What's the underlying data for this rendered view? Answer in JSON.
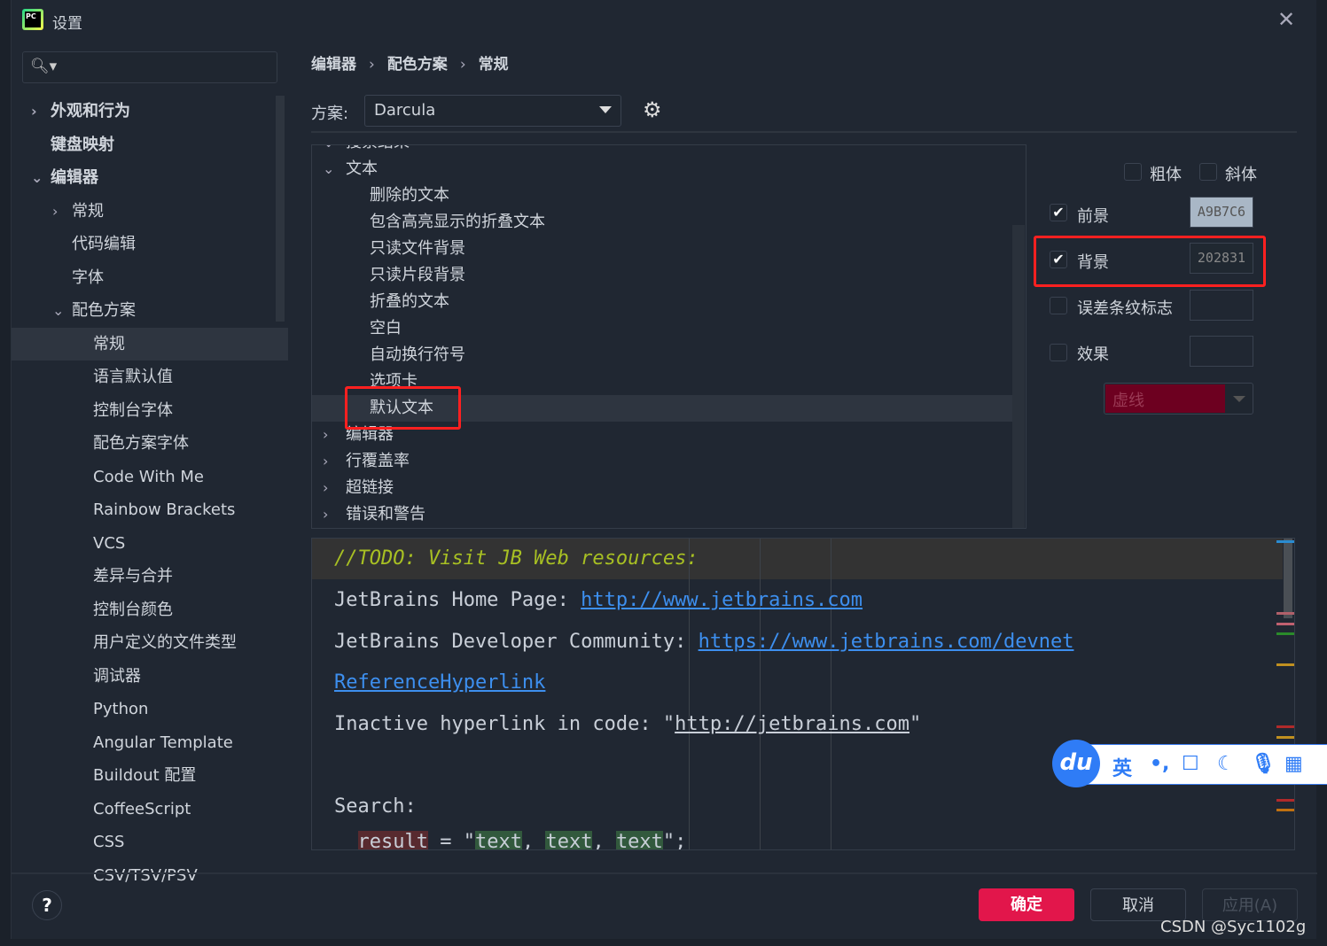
{
  "window": {
    "title": "设置",
    "close_icon": "close-icon"
  },
  "search": {
    "placeholder": ""
  },
  "sidebar": {
    "items": [
      {
        "label": "外观和行为",
        "level": 0,
        "expander": "right",
        "bold": true
      },
      {
        "label": "键盘映射",
        "level": 0,
        "expander": "",
        "bold": true
      },
      {
        "label": "编辑器",
        "level": 0,
        "expander": "down",
        "bold": true
      },
      {
        "label": "常规",
        "level": 1,
        "expander": "right"
      },
      {
        "label": "代码编辑",
        "level": 1,
        "expander": ""
      },
      {
        "label": "字体",
        "level": 1,
        "expander": ""
      },
      {
        "label": "配色方案",
        "level": 1,
        "expander": "down"
      },
      {
        "label": "常规",
        "level": 2,
        "expander": "",
        "selected": true
      },
      {
        "label": "语言默认值",
        "level": 2,
        "expander": ""
      },
      {
        "label": "控制台字体",
        "level": 2,
        "expander": ""
      },
      {
        "label": "配色方案字体",
        "level": 2,
        "expander": ""
      },
      {
        "label": "Code With Me",
        "level": 2,
        "expander": ""
      },
      {
        "label": "Rainbow Brackets",
        "level": 2,
        "expander": ""
      },
      {
        "label": "VCS",
        "level": 2,
        "expander": ""
      },
      {
        "label": "差异与合并",
        "level": 2,
        "expander": ""
      },
      {
        "label": "控制台颜色",
        "level": 2,
        "expander": ""
      },
      {
        "label": "用户定义的文件类型",
        "level": 2,
        "expander": ""
      },
      {
        "label": "调试器",
        "level": 2,
        "expander": ""
      },
      {
        "label": "Python",
        "level": 2,
        "expander": ""
      },
      {
        "label": "Angular Template",
        "level": 2,
        "expander": ""
      },
      {
        "label": "Buildout 配置",
        "level": 2,
        "expander": ""
      },
      {
        "label": "CoffeeScript",
        "level": 2,
        "expander": ""
      },
      {
        "label": "CSS",
        "level": 2,
        "expander": ""
      },
      {
        "label": "CSV/TSV/PSV",
        "level": 2,
        "expander": ""
      }
    ]
  },
  "breadcrumb": [
    "编辑器",
    "配色方案",
    "常规"
  ],
  "scheme": {
    "label": "方案:",
    "value": "Darcula"
  },
  "tree": {
    "items": [
      {
        "label": "搜索结果",
        "level": 0,
        "expander": "down"
      },
      {
        "label": "文本",
        "level": 0,
        "expander": "down"
      },
      {
        "label": "删除的文本",
        "level": 1
      },
      {
        "label": "包含高亮显示的折叠文本",
        "level": 1
      },
      {
        "label": "只读文件背景",
        "level": 1
      },
      {
        "label": "只读片段背景",
        "level": 1
      },
      {
        "label": "折叠的文本",
        "level": 1
      },
      {
        "label": "空白",
        "level": 1
      },
      {
        "label": "自动换行符号",
        "level": 1
      },
      {
        "label": "选项卡",
        "level": 1
      },
      {
        "label": "默认文本",
        "level": 1,
        "selected": true
      },
      {
        "label": "编辑器",
        "level": 0,
        "expander": "right"
      },
      {
        "label": "行覆盖率",
        "level": 0,
        "expander": "right"
      },
      {
        "label": "超链接",
        "level": 0,
        "expander": "right"
      },
      {
        "label": "错误和警告",
        "level": 0,
        "expander": "right"
      }
    ]
  },
  "attributes": {
    "bold": {
      "label": "粗体",
      "checked": false
    },
    "italic": {
      "label": "斜体",
      "checked": false
    },
    "foreground": {
      "label": "前景",
      "checked": true,
      "value": "A9B7C6",
      "color": "#A9B7C6"
    },
    "background": {
      "label": "背景",
      "checked": true,
      "value": "202831",
      "color": "#202831"
    },
    "error_stripe": {
      "label": "误差条纹标志",
      "checked": false,
      "value": ""
    },
    "effects": {
      "label": "效果",
      "checked": false,
      "value": "",
      "type": "虚线",
      "type_color": "#6d0020"
    }
  },
  "preview": {
    "todo": "//TODO: Visit JB Web resources:",
    "home_label": "JetBrains Home Page: ",
    "home_link": "http://www.jetbrains.com",
    "dev_label": "JetBrains Developer Community: ",
    "dev_link": "https://www.jetbrains.com/devnet",
    "ref_link": "ReferenceHyperlink",
    "inactive_label": "Inactive hyperlink in code: \"",
    "inactive_link": "http://jetbrains.com",
    "inactive_end": "\"",
    "search": "Search:",
    "code": {
      "indent": "  ",
      "result": "result",
      "eq": " = \"",
      "t1": "text",
      "s1": ", ",
      "t2": "text",
      "s2": ", ",
      "t3": "text",
      "end": "\";"
    }
  },
  "ime": {
    "logo": "du",
    "items": [
      "英",
      "•,",
      "☐",
      "☾",
      "🎙",
      "▦"
    ]
  },
  "footer": {
    "help": "?",
    "ok": "确定",
    "cancel": "取消",
    "apply": "应用(A)"
  },
  "watermark": "CSDN @Syc1102g",
  "colors": {
    "accent": "#e2164b",
    "link": "#3d8fef",
    "highlight_box": "#ff2020",
    "todo": "#a8c023"
  }
}
